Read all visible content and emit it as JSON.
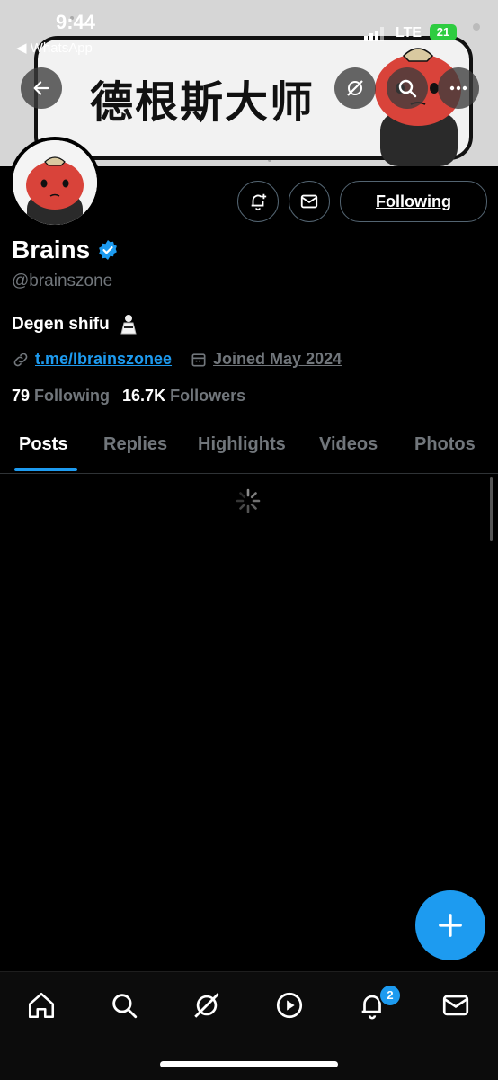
{
  "status": {
    "time": "9:44",
    "back_app": "◀ WhatsApp",
    "network": "LTE",
    "battery": "21"
  },
  "banner": {
    "title": "德根斯大师"
  },
  "profile": {
    "name": "Brains",
    "handle": "@brainszone",
    "bio": "Degen shifu",
    "link": "t.me/lbrainszonee",
    "joined": "Joined May 2024",
    "following_count": "79",
    "following_label": "Following",
    "followers_count": "16.7K",
    "followers_label": "Followers"
  },
  "actions": {
    "following_button": "Following"
  },
  "tabs": [
    {
      "label": "Posts"
    },
    {
      "label": "Replies"
    },
    {
      "label": "Highlights"
    },
    {
      "label": "Videos"
    },
    {
      "label": "Photos"
    }
  ],
  "nav": {
    "notifications_badge": "2"
  },
  "colors": {
    "accent": "#1d9bf0",
    "background": "#000000",
    "muted": "#71767b"
  },
  "icons": [
    "back-arrow-icon",
    "grok-icon",
    "search-icon",
    "more-icon",
    "bell-plus-icon",
    "mail-icon",
    "verified-badge-icon",
    "link-icon",
    "calendar-icon",
    "spinner-icon",
    "plus-icon",
    "home-icon",
    "explore-icon",
    "grok-icon",
    "video-icon",
    "bell-icon",
    "mail-icon"
  ]
}
